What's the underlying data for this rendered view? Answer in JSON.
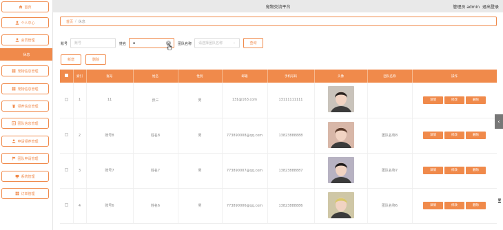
{
  "app": {
    "title": "宠物交流平台",
    "user_label": "管理员 admin",
    "logout": "退出登录"
  },
  "sidebar": {
    "items": [
      {
        "label": "首页",
        "icon": "home-icon"
      },
      {
        "label": "个人中心",
        "icon": "user-icon"
      },
      {
        "label": "会员管理",
        "icon": "user-icon"
      },
      {
        "label": "休息",
        "icon": "none",
        "active": true
      },
      {
        "label": "宠物信息管理",
        "icon": "grid-icon"
      },
      {
        "label": "宠物信息管理",
        "icon": "grid-icon"
      },
      {
        "label": "领养信息管理",
        "icon": "trash-icon"
      },
      {
        "label": "团队信息管理",
        "icon": "list-icon"
      },
      {
        "label": "申请领养管理",
        "icon": "user-icon"
      },
      {
        "label": "团队申请管理",
        "icon": "flag-icon"
      },
      {
        "label": "系统管理",
        "icon": "monitor-icon"
      },
      {
        "label": "订单管理",
        "icon": "grid-icon"
      }
    ]
  },
  "breadcrumb": {
    "home": "首页",
    "sep": "/",
    "current": "休息"
  },
  "search": {
    "account_label": "账号",
    "account_placeholder": "账号",
    "name_label": "姓名",
    "name_value": "a",
    "team_label": "团队名称",
    "team_placeholder": "请选择团队名称",
    "search_button": "查询",
    "add_button": "新增",
    "delete_button": "删除"
  },
  "table": {
    "columns": [
      "",
      "索引",
      "账号",
      "姓名",
      "性别",
      "邮箱",
      "手机号码",
      "头像",
      "团队名称",
      "操作"
    ],
    "actions": [
      "详情",
      "修改",
      "删除"
    ],
    "rows": [
      {
        "index": "1",
        "account": "11",
        "name": "张三",
        "gender": "男",
        "email": "131@163.com",
        "phone": "13111111111",
        "team": "",
        "photo": "p1"
      },
      {
        "index": "2",
        "account": "账号8",
        "name": "姓名8",
        "gender": "男",
        "email": "773890008@qq.com",
        "phone": "13823888888",
        "team": "团队名称8",
        "photo": "p2"
      },
      {
        "index": "3",
        "account": "账号7",
        "name": "姓名7",
        "gender": "男",
        "email": "773890007@qq.com",
        "phone": "13823888887",
        "team": "团队名称7",
        "photo": "p3"
      },
      {
        "index": "4",
        "account": "账号6",
        "name": "姓名6",
        "gender": "男",
        "email": "773890006@qq.com",
        "phone": "13823888886",
        "team": "团队名称6",
        "photo": "p4"
      }
    ]
  },
  "colors": {
    "accent": "#f08a4b",
    "topbar": "#e9e9e9"
  },
  "edge": {
    "collapse_arrow": "‹",
    "partial_char": "Ξ"
  }
}
